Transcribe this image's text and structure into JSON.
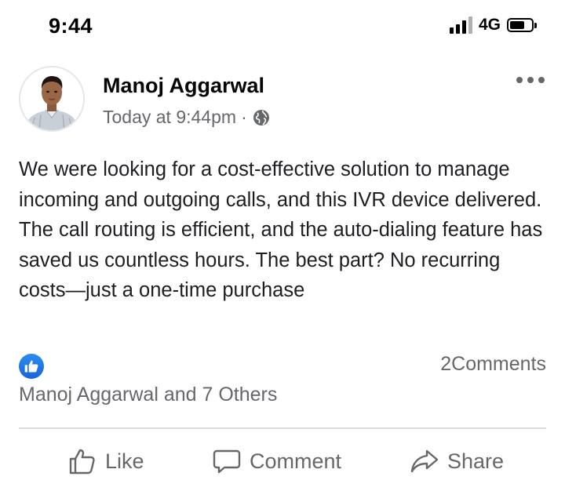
{
  "status_bar": {
    "time": "9:44",
    "network": "4G",
    "icons": [
      "signal-icon",
      "battery-icon"
    ]
  },
  "post": {
    "author": "Manoj Aggarwal",
    "timestamp": "Today at 9:44pm",
    "separator": "·",
    "privacy_icon": "globe-icon",
    "menu_icon": "more-options-icon",
    "text": "We were looking for a cost-effective solution to manage incoming and outgoing calls, and this IVR device delivered. The call routing is efficient, and the auto-dialing feature has saved us countless hours. The best part? No recurring costs—just a one-time purchase"
  },
  "reactions": {
    "icon": "like-reaction-icon",
    "comments_label": "2Comments",
    "reactors_label": "Manoj Aggarwal and 7 Others"
  },
  "actions": {
    "like_label": "Like",
    "comment_label": "Comment",
    "share_label": "Share"
  },
  "colors": {
    "accent": "#1877f2",
    "secondary_text": "#65676b",
    "primary_text": "#1c1e21",
    "divider": "#dadde1"
  }
}
